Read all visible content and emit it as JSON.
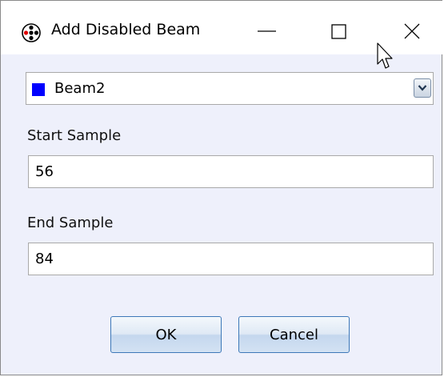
{
  "window": {
    "title": "Add Disabled Beam",
    "icon": "app-dots-icon",
    "controls": [
      "minimize-icon",
      "maximize-icon",
      "close-icon"
    ]
  },
  "beam_select": {
    "selected": "Beam2",
    "swatch_color": "#0000ff",
    "arrow_icon": "chevron-down-icon"
  },
  "start_sample": {
    "label": "Start Sample",
    "value": "56"
  },
  "end_sample": {
    "label": "End Sample",
    "value": "84"
  },
  "buttons": {
    "ok": "OK",
    "cancel": "Cancel"
  }
}
